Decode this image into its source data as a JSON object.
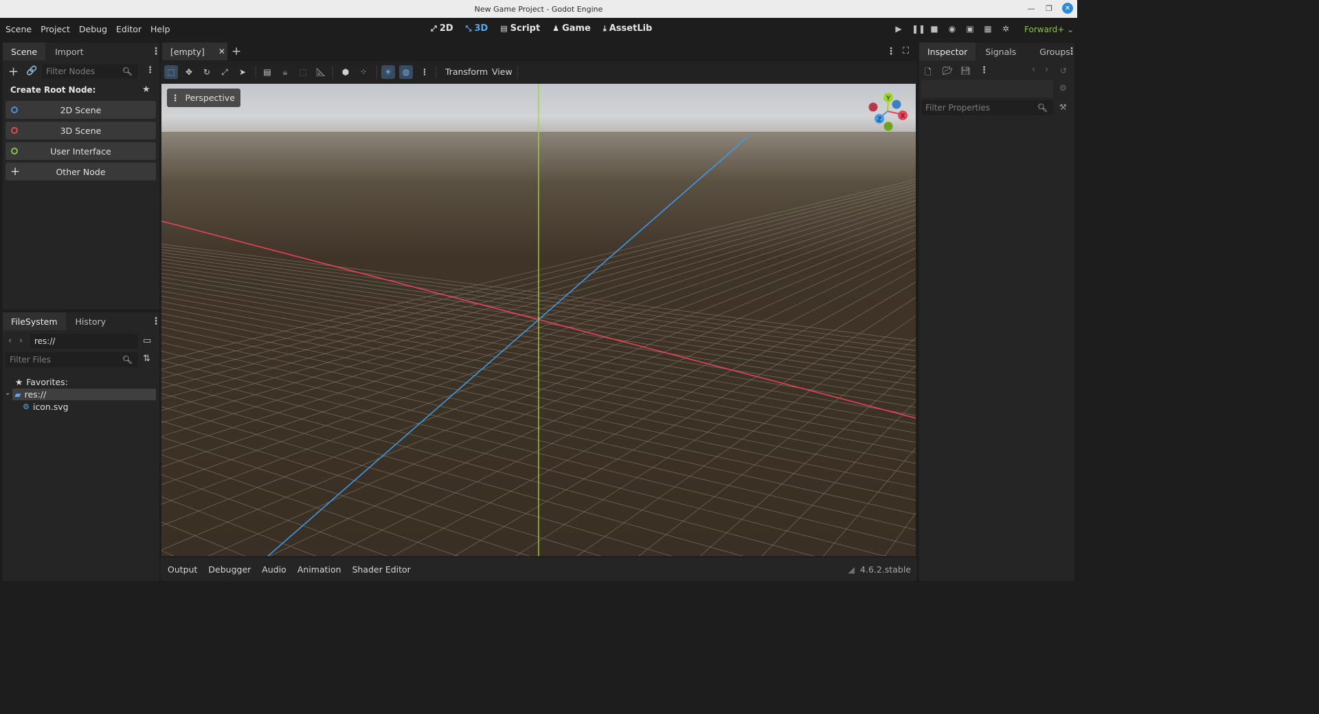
{
  "window": {
    "title": "New Game Project - Godot Engine"
  },
  "menu": [
    "Scene",
    "Project",
    "Debug",
    "Editor",
    "Help"
  ],
  "workspaces": [
    {
      "label": "2D",
      "icon": "2d-icon"
    },
    {
      "label": "3D",
      "icon": "3d-icon"
    },
    {
      "label": "Script",
      "icon": "script-icon"
    },
    {
      "label": "Game",
      "icon": "game-icon"
    },
    {
      "label": "AssetLib",
      "icon": "assetlib-icon"
    }
  ],
  "active_workspace": "3D",
  "renderer": "Forward+",
  "scene_dock": {
    "tabs": [
      "Scene",
      "Import"
    ],
    "filter_placeholder": "Filter Nodes",
    "create_root_label": "Create Root Node:",
    "buttons": [
      {
        "label": "2D Scene",
        "color": "#4a90d9"
      },
      {
        "label": "3D Scene",
        "color": "#e0475a"
      },
      {
        "label": "User Interface",
        "color": "#8dc150"
      },
      {
        "label": "Other Node"
      }
    ]
  },
  "filesystem_dock": {
    "tabs": [
      "FileSystem",
      "History"
    ],
    "path": "res://",
    "filter_placeholder": "Filter Files",
    "favorites_label": "Favorites:",
    "root_folder": "res://",
    "files": [
      "icon.svg"
    ]
  },
  "editor_tab": {
    "label": "[empty]"
  },
  "viewport": {
    "menus": [
      "Transform",
      "View"
    ],
    "perspective_label": "Perspective",
    "gizmo_axes": [
      "Y",
      "X",
      "Z"
    ],
    "colors": {
      "x_axis": "#e8435a",
      "y_axis": "#9fd62a",
      "z_axis": "#3d9be9"
    }
  },
  "bottom_panel": {
    "tabs": [
      "Output",
      "Debugger",
      "Audio",
      "Animation",
      "Shader Editor"
    ],
    "version": "4.6.2.stable"
  },
  "inspector_dock": {
    "tabs": [
      "Inspector",
      "Signals",
      "Groups"
    ],
    "filter_placeholder": "Filter Properties"
  }
}
